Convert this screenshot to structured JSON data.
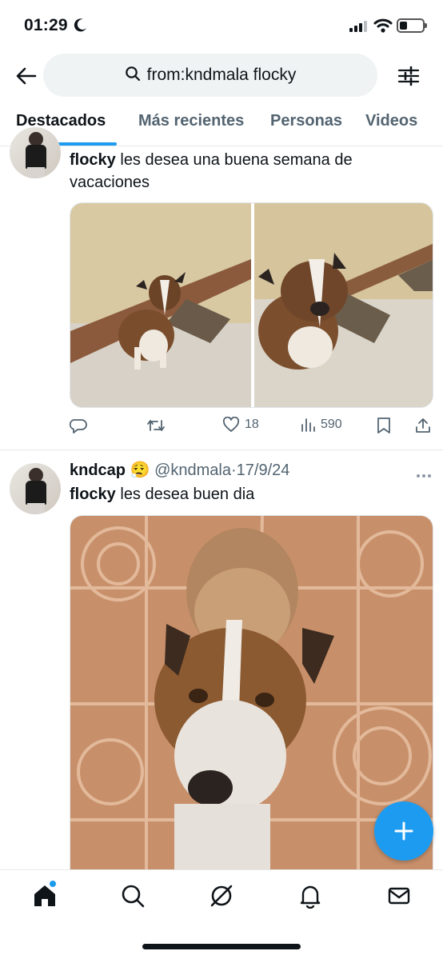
{
  "status": {
    "time": "01:29"
  },
  "search": {
    "query": "from:kndmala flocky"
  },
  "tabs": [
    {
      "label": "Destacados",
      "active": true
    },
    {
      "label": "Más recientes",
      "active": false
    },
    {
      "label": "Personas",
      "active": false
    },
    {
      "label": "Videos",
      "active": false
    }
  ],
  "tweets": [
    {
      "name_word": "flocky",
      "text": " les desea una buena semana de vacaciones",
      "media_count": 2,
      "actions": {
        "replies": "",
        "reposts": "",
        "likes": "18",
        "views": "590"
      }
    },
    {
      "author_name": "kndcap",
      "author_emoji": "😮‍💨",
      "handle": "@kndmala",
      "sep": "·",
      "date": "17/9/24",
      "name_word": "flocky",
      "text": " les desea buen dia",
      "media_count": 1
    }
  ],
  "colors": {
    "accent": "#1d9bf0",
    "muted": "#536471",
    "text": "#0f1419"
  }
}
